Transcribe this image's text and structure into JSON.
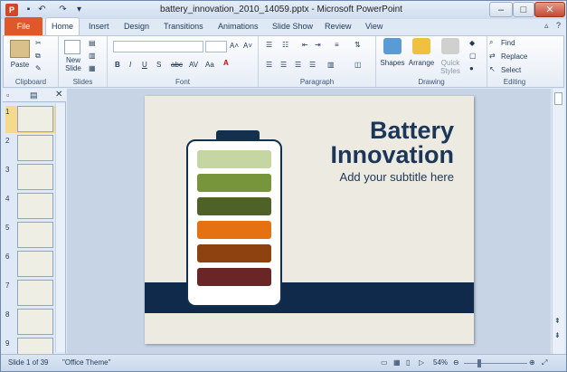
{
  "window": {
    "title": "battery_innovation_2010_14059.pptx - Microsoft PowerPoint",
    "app_icon": "P"
  },
  "tabs": {
    "file": "File",
    "home": "Home",
    "insert": "Insert",
    "design": "Design",
    "transitions": "Transitions",
    "animations": "Animations",
    "slideshow": "Slide Show",
    "review": "Review",
    "view": "View"
  },
  "ribbon": {
    "clipboard": {
      "label": "Clipboard",
      "paste": "Paste"
    },
    "slides": {
      "label": "Slides",
      "new_slide_1": "New",
      "new_slide_2": "Slide"
    },
    "font": {
      "label": "Font"
    },
    "paragraph": {
      "label": "Paragraph"
    },
    "drawing": {
      "label": "Drawing",
      "shapes": "Shapes",
      "arrange": "Arrange",
      "quick_1": "Quick",
      "quick_2": "Styles"
    },
    "editing": {
      "label": "Editing",
      "find": "Find",
      "replace": "Replace",
      "select": "Select"
    }
  },
  "thumbnails": [
    "1",
    "2",
    "3",
    "4",
    "5",
    "6",
    "7",
    "8",
    "9"
  ],
  "slide": {
    "title1": "Battery",
    "title2": "Innovation",
    "subtitle": "Add your subtitle here",
    "cells": [
      "#c5d6a3",
      "#77953a",
      "#4e6126",
      "#e47212",
      "#8e420f",
      "#6a2626"
    ]
  },
  "status": {
    "slide_of": "Slide 1 of 39",
    "theme": "\"Office Theme\"",
    "zoom": "54%"
  }
}
